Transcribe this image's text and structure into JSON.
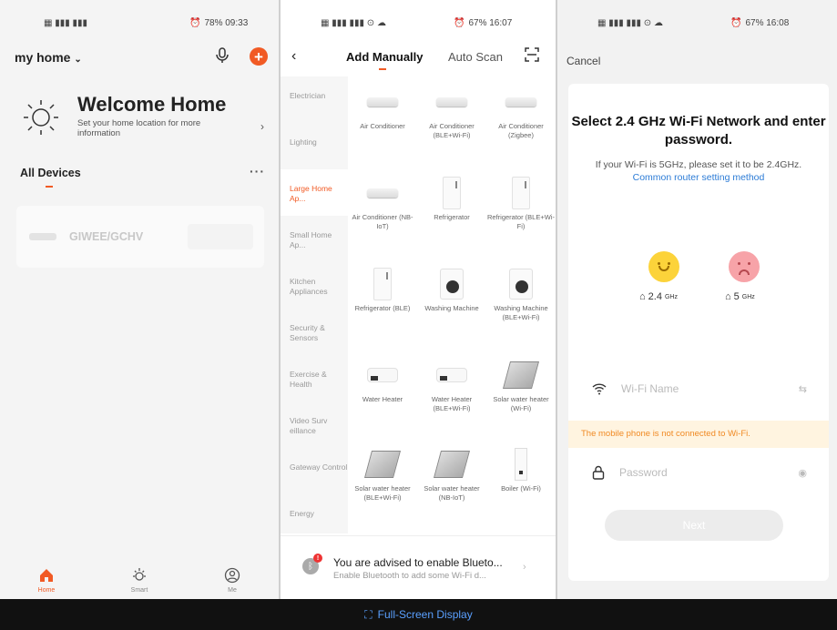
{
  "panel1": {
    "status": {
      "left": "📶 4G 4G",
      "right": "78% 09:33"
    },
    "home_title": "my home",
    "welcome_title": "Welcome Home",
    "welcome_sub": "Set your home location for more information",
    "all_devices": "All Devices",
    "device_name": "GIWEE/GCHV",
    "tabs": [
      {
        "label": "Home"
      },
      {
        "label": "Smart"
      },
      {
        "label": "Me"
      }
    ],
    "fullscreen": "Full-Screen Display"
  },
  "panel2": {
    "status": {
      "right": "67% 16:07"
    },
    "tab_manual": "Add Manually",
    "tab_scan": "Auto Scan",
    "categories": [
      "Electrician",
      "Lighting",
      "Large Home Ap...",
      "Small Home Ap...",
      "Kitchen Appliances",
      "Security & Sensors",
      "Exercise & Health",
      "Video Surv eillance",
      "Gateway Control",
      "Energy"
    ],
    "products": [
      [
        "Air Conditioner",
        "Air Conditioner (BLE+Wi-Fi)",
        "Air Conditioner (Zigbee)"
      ],
      [
        "Air Conditioner (NB-IoT)",
        "Refrigerator",
        "Refrigerator (BLE+Wi-Fi)"
      ],
      [
        "Refrigerator (BLE)",
        "Washing Machine",
        "Washing Machine (BLE+Wi-Fi)"
      ],
      [
        "Water Heater",
        "Water Heater (BLE+Wi-Fi)",
        "Solar water heater (Wi-Fi)"
      ],
      [
        "Solar water heater (BLE+Wi-Fi)",
        "Solar water heater (NB-IoT)",
        "Boiler (Wi-Fi)"
      ]
    ],
    "bt_title": "You are advised to enable Blueto...",
    "bt_sub": "Enable Bluetooth to add some Wi-Fi d...",
    "bt_badge": "!"
  },
  "panel3": {
    "status": {
      "right": "67% 16:08"
    },
    "cancel": "Cancel",
    "title": "Select 2.4 GHz Wi-Fi Network and enter password.",
    "sub_text": "If your Wi-Fi is 5GHz, please set it to be 2.4GHz.",
    "sub_link": "Common router setting method",
    "band_24": "2.4",
    "band_24_unit": "GHz",
    "band_5": "5",
    "band_5_unit": "GHz",
    "wifi_placeholder": "Wi-Fi Name",
    "warning": "The mobile phone is not connected to Wi-Fi.",
    "password_placeholder": "Password",
    "next": "Next"
  },
  "colors": {
    "accent": "#f15a24",
    "link": "#2b7bd6",
    "warning": "#f08a24"
  }
}
